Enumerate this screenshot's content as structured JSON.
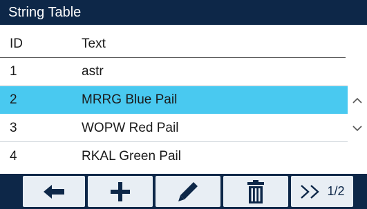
{
  "header": {
    "title": "String Table"
  },
  "table": {
    "columns": {
      "id": "ID",
      "text": "Text"
    },
    "rows": [
      {
        "id": "1",
        "text": "astr",
        "selected": false
      },
      {
        "id": "2",
        "text": "MRRG Blue Pail",
        "selected": true
      },
      {
        "id": "3",
        "text": "WOPW Red Pail",
        "selected": false
      },
      {
        "id": "4",
        "text": "RKAL Green Pail",
        "selected": false
      }
    ]
  },
  "scroll": {
    "up_icon": "chevron-up-icon",
    "down_icon": "chevron-down-icon"
  },
  "toolbar": {
    "buttons": [
      "back-arrow-icon",
      "plus-icon",
      "pencil-icon",
      "trash-icon",
      "double-chevron-right-icon"
    ],
    "page_indicator": "1/2"
  },
  "colors": {
    "titlebar": "#0d2748",
    "selection": "#49c9f0",
    "toolbar_button": "#e8eef4"
  }
}
